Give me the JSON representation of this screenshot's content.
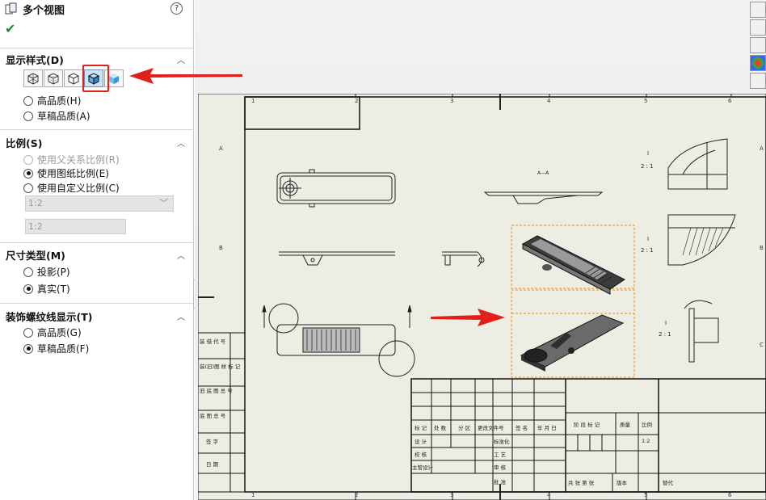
{
  "panel": {
    "title": "多个视图",
    "help": "?",
    "ok": "✔",
    "display_style": {
      "header": "显示样式(D)",
      "buttons": [
        "wireframe",
        "hidden-lines-visible",
        "hidden-lines-removed",
        "shaded-with-edges",
        "shaded"
      ],
      "selected_button": "shaded-with-edges",
      "options": [
        "高品质(H)",
        "草稿品质(A)"
      ]
    },
    "scale": {
      "header": "比例(S)",
      "options": [
        "使用父关系比例(R)",
        "使用图纸比例(E)",
        "使用自定义比例(C)"
      ],
      "dropdown": "1:2",
      "textbox": "1:2"
    },
    "dim_type": {
      "header": "尺寸类型(M)",
      "options": [
        "投影(P)",
        "真实(T)"
      ]
    },
    "thread": {
      "header": "装饰螺纹线显示(T)",
      "options": [
        "高品质(G)",
        "草稿品质(F)"
      ]
    }
  },
  "drawing": {
    "col_labels_top": [
      "1",
      "2",
      "3",
      "4",
      "5",
      "6"
    ],
    "row_labels_left": [
      "A",
      "B",
      "C"
    ],
    "section_label": "A—A",
    "scale_labels": [
      "I",
      "2 : 1",
      "I",
      "2 : 1",
      "I",
      "2 : 1"
    ],
    "side_table": [
      "装 借 代 号",
      "装(旧)图 样 标 记",
      "旧 底 图 总 号",
      "底 图 总 号",
      "签 字",
      "日 期"
    ],
    "title_block": {
      "headers": [
        "标 记",
        "处 数",
        "分 区",
        "更改文件号",
        "签 名",
        "年 月 日"
      ],
      "rows": [
        "设 计",
        "校 核",
        "主管设计"
      ],
      "mid": [
        "标准化",
        "工 艺",
        "审 核",
        "批 准"
      ],
      "right_headers": [
        "阶 段 标 记",
        "质量",
        "比例"
      ],
      "scale_value": "1:2",
      "bottom": [
        "共 张 第 张",
        "版本",
        "替代"
      ]
    }
  },
  "colors": {
    "accent_red": "#e0201a",
    "sheet_bg": "#eeede3",
    "selection_orange": "#f08a1c"
  }
}
